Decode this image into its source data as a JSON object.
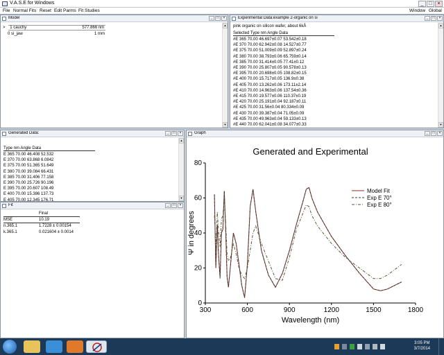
{
  "app": {
    "title": "V.A.S.E for Windows",
    "window_buttons": [
      "_",
      "□",
      "×"
    ]
  },
  "menu": {
    "left": [
      "File",
      "Normal Fits",
      "Reset",
      "Edit Parms",
      "Fit Studies"
    ],
    "right": [
      "Window",
      "Global"
    ]
  },
  "model_window": {
    "title": "Model",
    "layers": [
      {
        "prefix": ">",
        "index": "1",
        "name": "cauchy",
        "value": "577.866 nm"
      },
      {
        "prefix": "",
        "index": "0",
        "name": "si_jaw",
        "value": "1 mm"
      }
    ]
  },
  "experimental_window": {
    "title": "Experimental Data:example 2-organic on si",
    "subtitle": "pink organic on silicon wafer, about 6kÅ",
    "header": "Selected Type  nm  Angle  Data",
    "rows": [
      "#E 365  70.00  46.697±0.07  53.542±0.18",
      "#E 370  70.00  62.942±0.08  14.527±0.77",
      "#E 375  70.00  51.009±0.09  52.897±0.24",
      "#E 380  70.00  38.793±0.06  65.759±0.14",
      "#E 385  70.00  31.414±0.05  77.41±0.12",
      "#E 390  70.00  25.807±0.05  90.578±0.13",
      "#E 395  70.00  20.698±0.05  108.82±0.15",
      "#E 400  70.00  15.717±0.05  136.9±0.38",
      "#E 405  70.00  13.262±0.06  173.11±2.14",
      "#E 410  70.00  14.963±0.06  137.54±0.36",
      "#E 415  70.00  19.577±0.06  110.37±0.19",
      "#E 420  70.00  25.191±0.04  92.187±0.11",
      "#E 425  70.00  31.56±0.04  80.334±0.09",
      "#E 430  70.00  39.387±0.04  71.05±0.09",
      "#E 435  70.00  49.963±0.04  59.133±0.13",
      "#E 440  70.00  62.041±0.08  34.077±0.33"
    ]
  },
  "generated_window": {
    "title": "Generated Data:",
    "header": "Type  nm  Angle  Data",
    "rows": [
      "E  365  70.00  46.408  52.532",
      "E  370  70.00  63.868  6.0842",
      "E  375  70.00  51.365  51.649",
      "E  380  70.00  39.084  66.431",
      "E  385  70.00  31.406  77.158",
      "E  390  70.00  25.726  90.196",
      "E  395  70.00  20.607  108.49",
      "E  400  70.00  15.386  137.73",
      "E  405  70.00  12.345  176.71"
    ]
  },
  "fit_window": {
    "title": "Fit",
    "header": "Final",
    "rows": [
      {
        "label": "MSE",
        "value": "10.19"
      },
      {
        "label": "n.365.1",
        "value": "1.7228 ± 0.00154"
      },
      {
        "label": "k.365.1",
        "value": "0.021604 ± 0.0014"
      }
    ]
  },
  "graph_window": {
    "title": "Graph"
  },
  "chart_data": {
    "type": "line",
    "title": "Generated and Experimental",
    "xlabel": "Wavelength (nm)",
    "ylabel": "Ψ in degrees",
    "xlim": [
      300,
      1800
    ],
    "ylim": [
      0,
      80
    ],
    "xticks": [
      300,
      600,
      900,
      1200,
      1500,
      1800
    ],
    "yticks": [
      0,
      20,
      40,
      60,
      80
    ],
    "grid": false,
    "legend_position": "right",
    "series": [
      {
        "name": "Model Fit",
        "color": "#8b2d20",
        "style": "solid",
        "x": [
          365,
          375,
          385,
          395,
          405,
          415,
          425,
          435,
          445,
          455,
          465,
          480,
          500,
          520,
          540,
          560,
          580,
          600,
          620,
          640,
          660,
          700,
          750,
          800,
          850,
          900,
          950,
          1000,
          1020,
          1040,
          1060,
          1100,
          1200,
          1300,
          1400,
          1500,
          1550,
          1600,
          1700
        ],
        "y": [
          62,
          20,
          45,
          26,
          15,
          40,
          42,
          64,
          42,
          15,
          9,
          22,
          40,
          34,
          22,
          10,
          3,
          22,
          55,
          65,
          52,
          30,
          16,
          9,
          17,
          30,
          45,
          59,
          65,
          66,
          60,
          52,
          38,
          27,
          17,
          8,
          7,
          8,
          12
        ]
      },
      {
        "name": "Exp E 70°",
        "color": "#3a3a3a",
        "style": "dashed",
        "x": [
          365,
          375,
          385,
          395,
          405,
          415,
          425,
          435,
          445,
          455,
          465,
          480,
          500,
          520,
          540,
          560,
          580,
          600,
          620,
          640,
          660,
          700,
          750,
          800,
          850,
          900,
          950,
          1000,
          1020,
          1040,
          1060,
          1100,
          1200,
          1300,
          1400,
          1500,
          1550,
          1600,
          1700
        ],
        "y": [
          62,
          20,
          45,
          26,
          14,
          40,
          43,
          64,
          42,
          15,
          9,
          22,
          40,
          34,
          22,
          10,
          3,
          22,
          55,
          65,
          52,
          30,
          16,
          9,
          17,
          30,
          45,
          59,
          65,
          66,
          60,
          52,
          38,
          27,
          17,
          8,
          7,
          8,
          12
        ]
      },
      {
        "name": "Exp E 80°",
        "color": "#5a5a3a",
        "style": "dashdot",
        "x": [
          365,
          375,
          385,
          395,
          405,
          415,
          425,
          435,
          445,
          455,
          465,
          480,
          500,
          520,
          540,
          560,
          580,
          600,
          620,
          640,
          660,
          700,
          750,
          800,
          850,
          900,
          950,
          1000,
          1020,
          1040,
          1060,
          1100,
          1200,
          1300,
          1400,
          1500,
          1550,
          1600,
          1700
        ],
        "y": [
          50,
          30,
          52,
          40,
          32,
          48,
          50,
          60,
          46,
          28,
          24,
          26,
          34,
          28,
          20,
          16,
          14,
          20,
          30,
          40,
          44,
          34,
          24,
          14,
          13,
          26,
          42,
          52,
          56,
          55,
          50,
          44,
          34,
          26,
          20,
          14,
          14,
          16,
          22
        ]
      }
    ]
  },
  "taskbar": {
    "time": "3:05 PM",
    "date": "3/7/2014"
  }
}
